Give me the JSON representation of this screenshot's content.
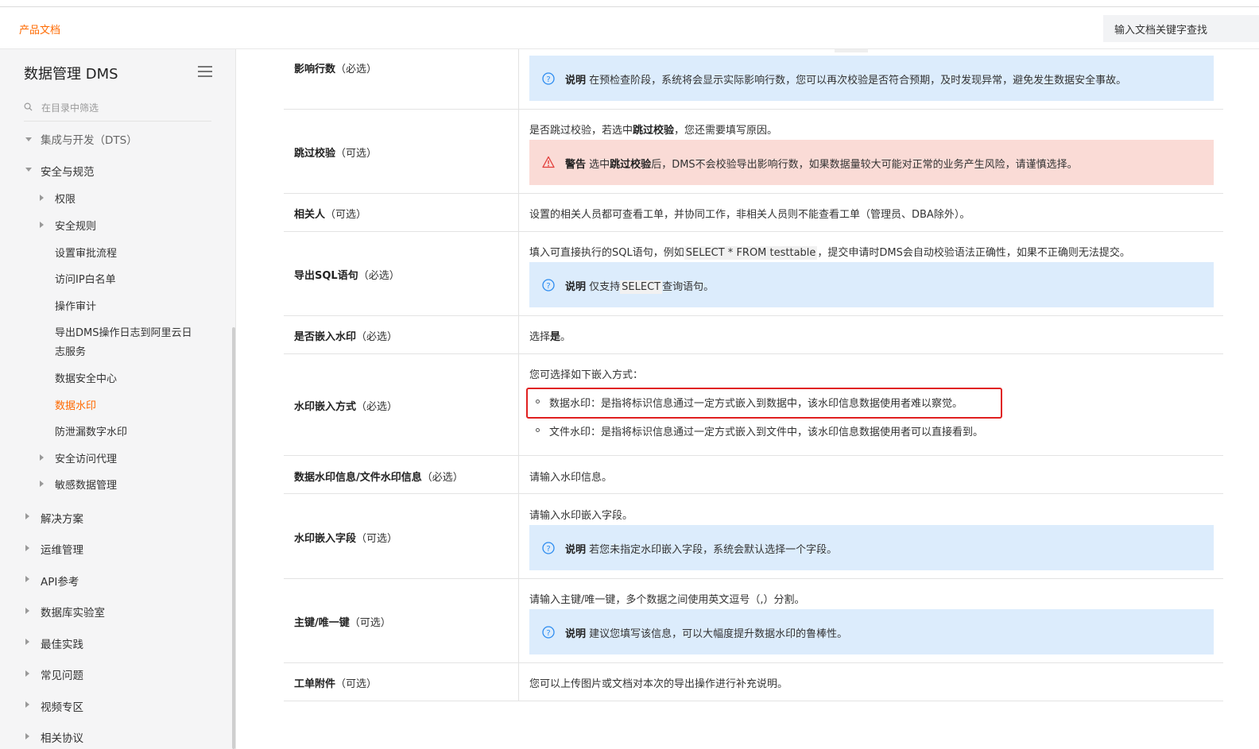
{
  "header": {
    "brand": "产品文档",
    "search_placeholder": "输入文档关键字查找"
  },
  "sidebar": {
    "title": "数据管理 DMS",
    "filter_placeholder": "在目录中筛选",
    "items": [
      {
        "label": "集成与开发（DTS）"
      },
      {
        "label": "安全与规范"
      },
      {
        "label": "权限"
      },
      {
        "label": "安全规则"
      },
      {
        "label": "设置审批流程"
      },
      {
        "label": "访问IP白名单"
      },
      {
        "label": "操作审计"
      },
      {
        "label": "导出DMS操作日志到阿里云日"
      },
      {
        "label": "志服务"
      },
      {
        "label": "数据安全中心"
      },
      {
        "label": "数据水印"
      },
      {
        "label": "防泄漏数字水印"
      },
      {
        "label": "安全访问代理"
      },
      {
        "label": "敏感数据管理"
      },
      {
        "label": "解决方案"
      },
      {
        "label": "运维管理"
      },
      {
        "label": "API参考"
      },
      {
        "label": "数据库实验室"
      },
      {
        "label": "最佳实践"
      },
      {
        "label": "常见问题"
      },
      {
        "label": "视频专区"
      },
      {
        "label": "相关协议"
      }
    ]
  },
  "table": {
    "rows": [
      {
        "name": "影响行数",
        "req": "（必选）",
        "note_label": "说明",
        "note": "在预检查阶段，系统将会显示实际影响行数，您可以再次校验是否符合预期，及时发现异常，避免发生数据安全事故。"
      },
      {
        "name": "跳过校验",
        "req": "（可选）",
        "desc_a": "是否跳过校验，若选中",
        "desc_b": "跳过校验",
        "desc_c": "，您还需要填写原因。",
        "warn_label": "警告",
        "warn_a": "选中",
        "warn_b": "跳过校验",
        "warn_c": "后，DMS不会校验导出影响行数，如果数据量较大可能对正常的业务产生风险，请谨慎选择。"
      },
      {
        "name": "相关人",
        "req": "（可选）",
        "desc": "设置的相关人员都可查看工单，并协同工作，非相关人员则不能查看工单（管理员、DBA除外）。"
      },
      {
        "name": "导出SQL语句",
        "req": "（必选）",
        "desc_a": "填入可直接执行的SQL语句，例如",
        "desc_code": "SELECT * FROM testtable",
        "desc_c": "，提交申请时DMS会自动校验语法正确性，如果不正确则无法提交。",
        "note_label": "说明",
        "note_a": "仅支持",
        "note_code": "SELECT",
        "note_c": "查询语句。"
      },
      {
        "name": "是否嵌入水印",
        "req": "（必选）",
        "desc_a": "选择",
        "desc_b": "是",
        "desc_c": "。"
      },
      {
        "name": "水印嵌入方式",
        "req": "（必选）",
        "desc": "您可选择如下嵌入方式：",
        "bullets": [
          "数据水印：是指将标识信息通过一定方式嵌入到数据中，该水印信息数据使用者难以察觉。",
          "文件水印：是指将标识信息通过一定方式嵌入到文件中，该水印信息数据使用者可以直接看到。"
        ]
      },
      {
        "name": "数据水印信息/文件水印信息",
        "req": "（必选）",
        "desc": "请输入水印信息。"
      },
      {
        "name": "水印嵌入字段",
        "req": "（可选）",
        "desc": "请输入水印嵌入字段。",
        "note_label": "说明",
        "note": "若您未指定水印嵌入字段，系统会默认选择一个字段。"
      },
      {
        "name": "主键/唯一键",
        "req": "（可选）",
        "desc": "请输入主键/唯一键，多个数据之间使用英文逗号（,）分割。",
        "note_label": "说明",
        "note": "建议您填写该信息，可以大幅度提升数据水印的鲁棒性。"
      },
      {
        "name": "工单附件",
        "req": "（可选）",
        "desc": "您可以上传图片或文档对本次的导出操作进行补充说明。"
      }
    ]
  },
  "colors": {
    "accent": "#ff6a00",
    "note_bg": "#dcecfc",
    "warn_bg": "#fadbd6",
    "highlight_border": "#e02020"
  },
  "icons": {
    "info": "question-circle-icon",
    "warn": "warning-triangle-icon",
    "menu": "hamburger-menu-icon",
    "search": "search-icon"
  }
}
